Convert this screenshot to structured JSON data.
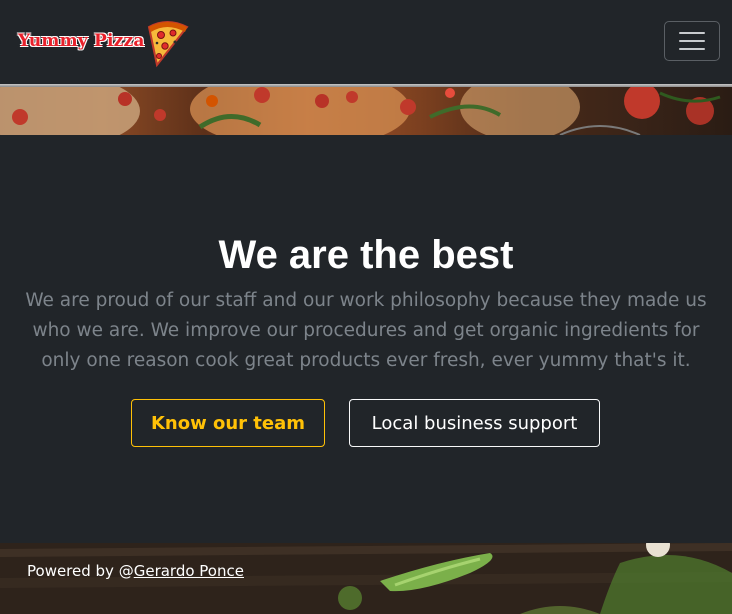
{
  "navbar": {
    "brand": "Yummy Pizza",
    "brand_icon": "pizza-slice-icon",
    "toggler_icon": "hamburger-menu-icon"
  },
  "hero": {
    "title": "We are the best",
    "lead": "We are proud of our staff and our work philosophy because they made us who we are. We improve our procedures and get organic ingredients for only one reason cook great products ever fresh, ever yummy that's it."
  },
  "buttons": {
    "team_label": "Know our team",
    "local_label": "Local business support"
  },
  "footer": {
    "prefix": "Powered by @",
    "author": "Gerardo Ponce"
  },
  "colors": {
    "background": "#212529",
    "accent": "#ffc107",
    "muted_text": "#7d848b",
    "brand": "#e8202a"
  }
}
